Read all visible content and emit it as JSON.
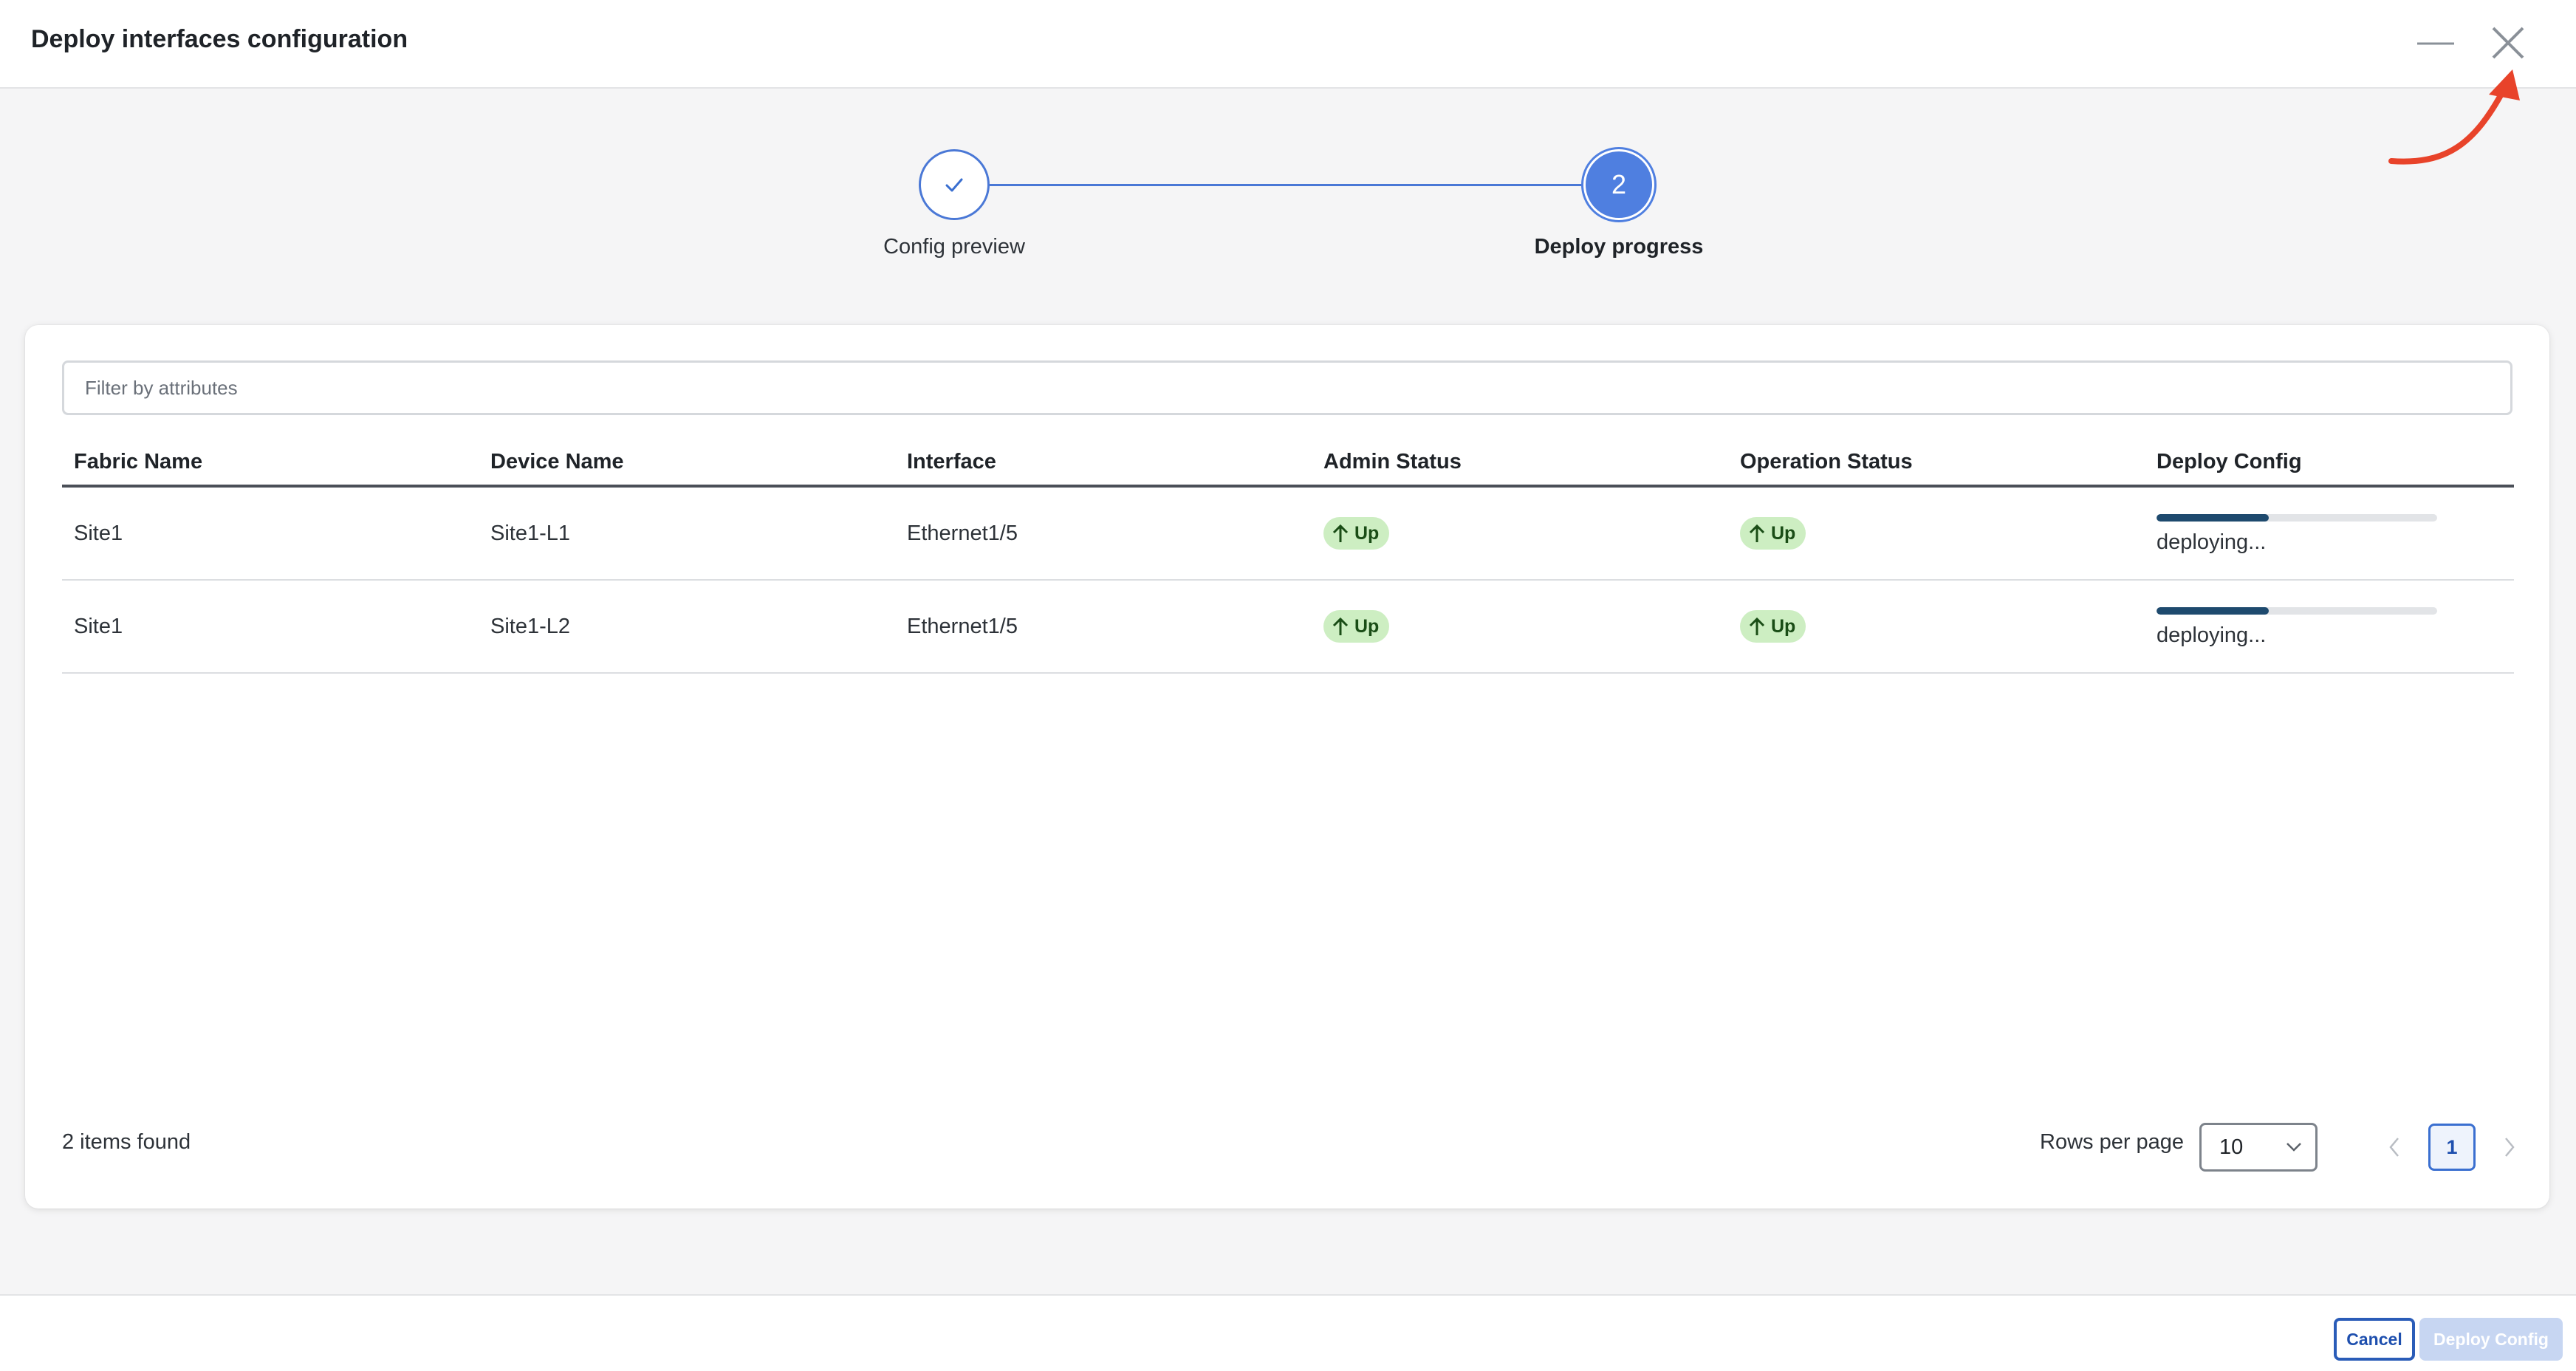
{
  "header": {
    "title": "Deploy interfaces configuration",
    "minimize_icon": "minimize-icon",
    "close_icon": "close-icon"
  },
  "stepper": {
    "steps": [
      {
        "label": "Config preview",
        "state": "completed",
        "icon": "checkmark-icon"
      },
      {
        "label": "Deploy progress",
        "state": "active",
        "number": "2"
      }
    ]
  },
  "filter": {
    "placeholder": "Filter by attributes",
    "value": ""
  },
  "table": {
    "columns": [
      "Fabric Name",
      "Device Name",
      "Interface",
      "Admin Status",
      "Operation Status",
      "Deploy Config"
    ],
    "rows": [
      {
        "fabric": "Site1",
        "device": "Site1-L1",
        "interface": "Ethernet1/5",
        "admin_status": "Up",
        "operation_status": "Up",
        "deploy_progress": 0.4,
        "deploy_text": "deploying..."
      },
      {
        "fabric": "Site1",
        "device": "Site1-L2",
        "interface": "Ethernet1/5",
        "admin_status": "Up",
        "operation_status": "Up",
        "deploy_progress": 0.4,
        "deploy_text": "deploying..."
      }
    ]
  },
  "pagination": {
    "items_found": "2 items found",
    "rows_per_page_label": "Rows per page",
    "rows_per_page_value": "10",
    "current_page": "1"
  },
  "footer": {
    "cancel_label": "Cancel",
    "deploy_label": "Deploy Config"
  },
  "colors": {
    "accent": "#4f7fe0",
    "status_up_bg": "#cdeec2",
    "progress_fill": "#1e4a6e",
    "annotation_arrow": "#e8432a"
  }
}
